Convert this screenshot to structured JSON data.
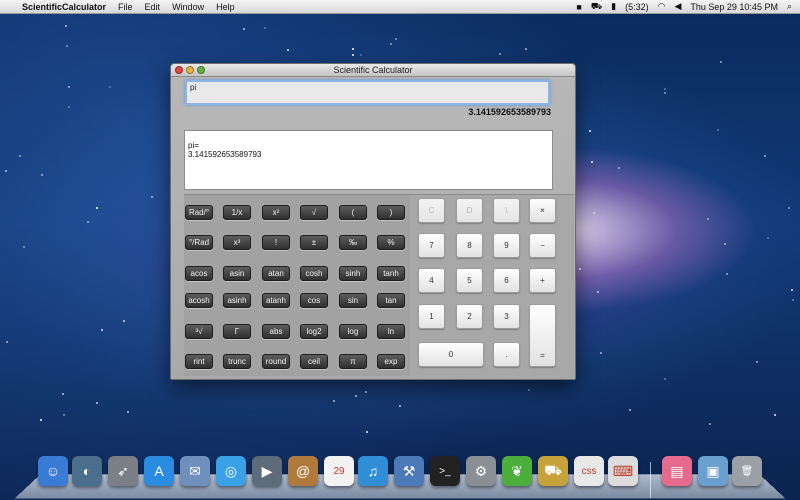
{
  "menubar": {
    "apple_glyph": "",
    "app_name": "ScientificCalculator",
    "menus": [
      "File",
      "Edit",
      "Window",
      "Help"
    ],
    "battery": "(5:32)",
    "datetime": "Thu Sep 29  10:45 PM",
    "status_icons": [
      "camera-icon",
      "truck-icon",
      "battery-icon",
      "wifi-icon",
      "speaker-icon",
      "search-icon"
    ]
  },
  "window": {
    "title": "Scientific Calculator",
    "input_value": "pi",
    "result": "3.141592653589793",
    "history": [
      "pi=",
      "3.141592653589793"
    ]
  },
  "function_keys": [
    [
      "Rad/°",
      "1/x",
      "x²",
      "√",
      "(",
      ")"
    ],
    [
      "°/Rad",
      "x³",
      "!",
      "±",
      "‰",
      "%"
    ],
    [
      "acos",
      "asin",
      "atan",
      "cosh",
      "sinh",
      "tanh"
    ],
    [
      "acosh",
      "asinh",
      "atanh",
      "cos",
      "sin",
      "tan"
    ],
    [
      "³√",
      "Γ",
      "abs",
      "log2",
      "log",
      "ln"
    ],
    [
      "rint",
      "trunc",
      "round",
      "ceil",
      "π",
      "exp"
    ]
  ],
  "number_keys": [
    [
      "C",
      "D",
      "\\",
      "×"
    ],
    [
      "7",
      "8",
      "9",
      "−"
    ],
    [
      "4",
      "5",
      "6",
      "+"
    ],
    [
      "1",
      "2",
      "3"
    ],
    [
      "0",
      "."
    ]
  ],
  "equals_key": "=",
  "dock": {
    "items": [
      {
        "name": "finder-icon",
        "color": "#3a7bd5",
        "glyph": "☺"
      },
      {
        "name": "dashboard-icon",
        "color": "#4a6e8c",
        "glyph": "◐"
      },
      {
        "name": "launchpad-icon",
        "color": "#7a7f88",
        "glyph": "➶"
      },
      {
        "name": "app-store-icon",
        "color": "#2a8ce0",
        "glyph": "A"
      },
      {
        "name": "mail-icon",
        "color": "#6f8fbd",
        "glyph": "✉"
      },
      {
        "name": "safari-icon",
        "color": "#3aa0e8",
        "glyph": "◎"
      },
      {
        "name": "facetime-icon",
        "color": "#5d6b7a",
        "glyph": "▶"
      },
      {
        "name": "address-book-icon",
        "color": "#b07a3c",
        "glyph": "@"
      },
      {
        "name": "calendar-icon",
        "color": "#f2f2f2",
        "glyph": "29"
      },
      {
        "name": "itunes-icon",
        "color": "#2f8ed6",
        "glyph": "♫"
      },
      {
        "name": "xcode-icon",
        "color": "#4c79b8",
        "glyph": "⚒"
      },
      {
        "name": "terminal-icon",
        "color": "#222222",
        "glyph": ">_"
      },
      {
        "name": "system-preferences-icon",
        "color": "#8a8f96",
        "glyph": "⚙"
      },
      {
        "name": "leaf-icon",
        "color": "#4caf3c",
        "glyph": "❦"
      },
      {
        "name": "transmit-icon",
        "color": "#c7a23a",
        "glyph": "⛟"
      },
      {
        "name": "css-editor-icon",
        "color": "#e8e8e8",
        "glyph": "css"
      },
      {
        "name": "keyboard-icon",
        "color": "#dcdcdc",
        "glyph": "⌨"
      },
      {
        "name": "downloads-folder-icon",
        "color": "#e56a8e",
        "glyph": "▤"
      },
      {
        "name": "screen-sharing-icon",
        "color": "#6aa0cf",
        "glyph": "▣"
      },
      {
        "name": "trash-icon",
        "color": "#9aa0a6",
        "glyph": "🗑"
      }
    ]
  }
}
